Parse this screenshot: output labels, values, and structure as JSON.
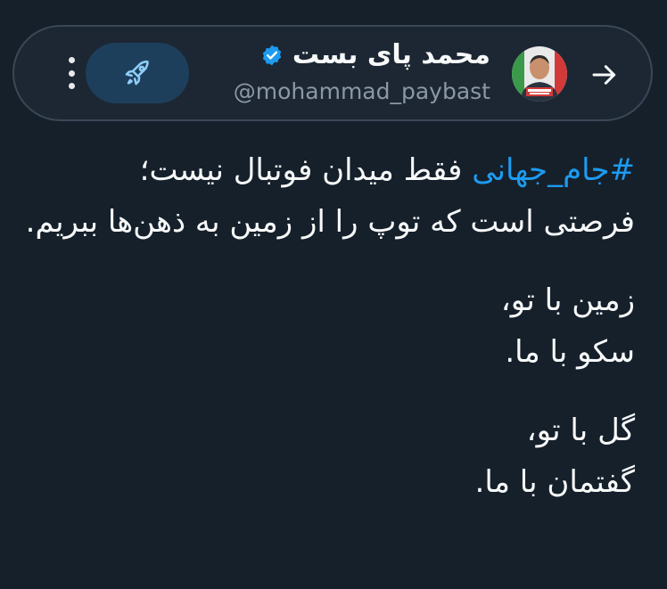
{
  "header": {
    "display_name": "محمد پای بست",
    "handle": "@mohammad_paybast",
    "verified": true,
    "colors": {
      "accent": "#1d9bf0",
      "boost_bg": "#1e3f5c",
      "boost_icon": "#8ecdf8"
    },
    "icons": {
      "more": "more-vertical-icon",
      "boost": "rocket-icon",
      "back": "arrow-right-icon",
      "verified": "verified-badge-icon"
    }
  },
  "tweet": {
    "hashtag": "#جام_جهانی",
    "line1_rest": " فقط میدان فوتبال نیست؛",
    "line1_cont": "فرصتی است که توپ را از زمین به ذهن‌ها ببریم.",
    "stanza2_line1": "زمین با تو،",
    "stanza2_line2": "سکو با ما.",
    "stanza3_line1": "گل با تو،",
    "stanza3_line2": "گفتمان با ما."
  }
}
